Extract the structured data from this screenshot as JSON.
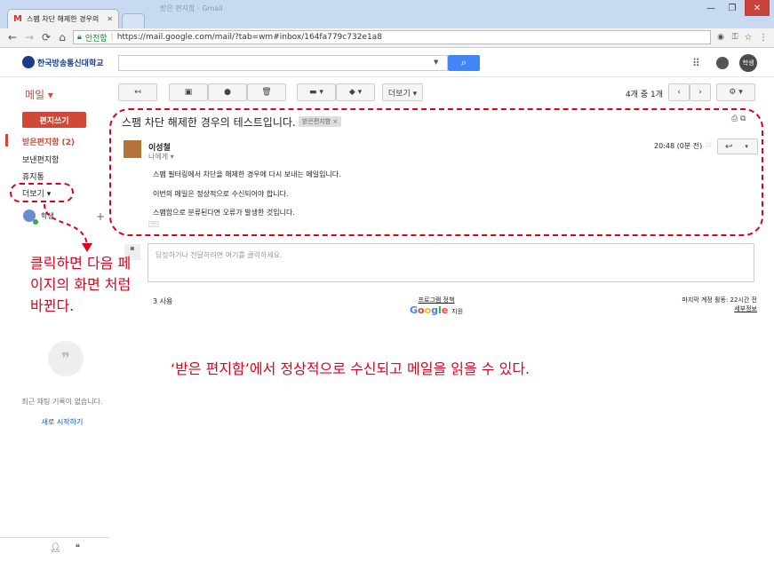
{
  "browser": {
    "tab_title": "스팸 차단 해제한 경우의",
    "window_title": "받은 편지함 - Gmail",
    "security_label": "안전함",
    "url": "https://mail.google.com/mail/?tab=wm#inbox/164fa779c732e1a8"
  },
  "header": {
    "logo_text": "한국방송통신대학교",
    "avatar_text": "학생"
  },
  "toolbar": {
    "mail_label": "메일 ▾",
    "more_label": "더보기 ▾",
    "count_text": "4개 중 1개"
  },
  "sidebar": {
    "compose_label": "편지쓰기",
    "items": [
      {
        "label": "받은편지함 (2)"
      },
      {
        "label": "보낸편지함"
      },
      {
        "label": "휴지통"
      },
      {
        "label": "더보기 ▾"
      }
    ],
    "user_label": "학생",
    "chat_empty": "최근 채팅 기록이 없습니다.",
    "chat_link": "새로 시작하기"
  },
  "message": {
    "subject": "스팸 차단 해제한 경우의 테스트입니다.",
    "label_chip": "받은편지함 ×",
    "sender": "이성철",
    "to_me": "나에게 ▾",
    "time": "20:48 (0분 전)",
    "body": [
      "스팸 필터링에서 차단을 해제한 경우에 다시 보내는 메일입니다.",
      "이번의 메일은 정상적으로 수신되어야 합니다.",
      "스팸함으로 분류된다면 오류가 발생한 것입니다."
    ],
    "reply_placeholder": "답장하거나 전달하려면 여기를 클릭하세요."
  },
  "footer": {
    "usage": "3 사용",
    "policy": "프로그램 정책",
    "google_support": "지원",
    "last_activity": "마지막 계정 활동: 22시간 전",
    "details": "세부정보"
  },
  "annotations": {
    "left_note": "클릭하면 다음 페이지의 화면 처럼 바뀐다.",
    "main_note": "‘받은 편지함’에서 정상적으로 수신되고 메일을 읽을 수 있다."
  },
  "colors": {
    "accent": "#d14836",
    "annotation": "#e0001a",
    "search": "#4285f4"
  }
}
